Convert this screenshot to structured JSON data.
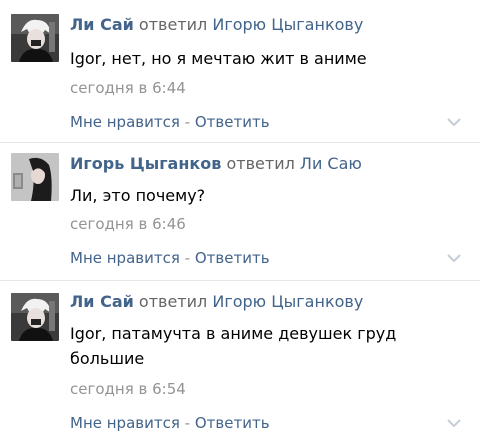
{
  "comments": [
    {
      "author": "Ли Сай",
      "verb": "ответил",
      "target": "Игорю Цыганкову",
      "text": "Igor, нет, но я мечтаю жит в аниме",
      "time": "сегодня в 6:44",
      "like_label": "Мне нравится",
      "separator": "-",
      "reply_label": "Ответить",
      "avatar": "anime-character-white-hair"
    },
    {
      "author": "Игорь Цыганков",
      "verb": "ответил",
      "target": "Ли Саю",
      "text": "Ли, это почему?",
      "time": "сегодня в 6:46",
      "like_label": "Мне нравится",
      "separator": "-",
      "reply_label": "Ответить",
      "avatar": "girl-long-dark-hair"
    },
    {
      "author": "Ли Сай",
      "verb": "ответил",
      "target": "Игорю Цыганкову",
      "text": "Igor, патамучта в аниме девушек груд большие",
      "time": "сегодня в 6:54",
      "like_label": "Мне нравится",
      "separator": "-",
      "reply_label": "Ответить",
      "avatar": "anime-character-white-hair"
    }
  ]
}
